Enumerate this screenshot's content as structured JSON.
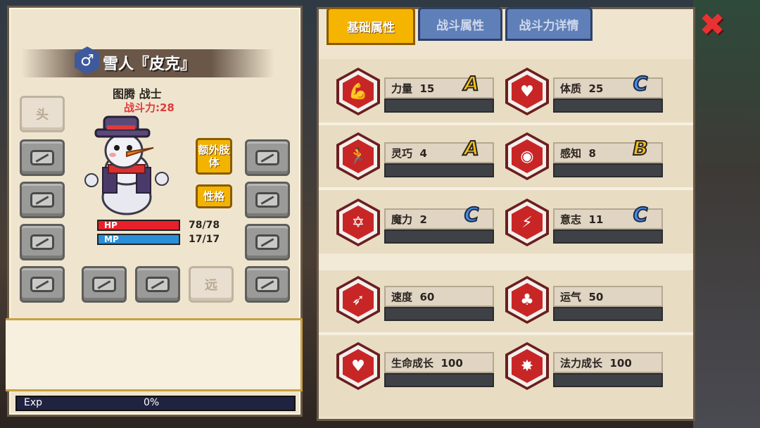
{
  "character": {
    "gender_symbol": "♂",
    "name": "雪人『皮克』",
    "subtitle": "图腾 战士",
    "power": "战斗力:28",
    "hp_label": "HP",
    "hp": 78,
    "hp_max": 78,
    "hp_text": "78/78",
    "mp_label": "MP",
    "mp": 17,
    "mp_max": 17,
    "mp_text": "17/17",
    "extra_limb_button": "额外肢体",
    "personality_button": "性格",
    "head_slot": "头",
    "ranged_slot": "远",
    "exp_label": "Exp",
    "exp_value": "0%",
    "exp_fraction": 0.0,
    "hp_color": "#e8202a",
    "mp_color": "#2a8fd8"
  },
  "tabs": [
    {
      "label": "基础属性",
      "active": true
    },
    {
      "label": "战斗属性",
      "active": false
    },
    {
      "label": "战斗力详情",
      "active": false
    }
  ],
  "attributes": [
    {
      "key": "strength",
      "label": "力量",
      "value": "15",
      "grade": "A",
      "icon": "flexed-arm-icon"
    },
    {
      "key": "constitution",
      "label": "体质",
      "value": "25",
      "grade": "C",
      "icon": "muscle-torso-icon"
    },
    {
      "key": "agility",
      "label": "灵巧",
      "value": "4",
      "grade": "A",
      "icon": "running-man-icon"
    },
    {
      "key": "perception",
      "label": "感知",
      "value": "8",
      "grade": "B",
      "icon": "eye-icon"
    },
    {
      "key": "magic",
      "label": "魔力",
      "value": "2",
      "grade": "C",
      "icon": "hexagram-icon"
    },
    {
      "key": "will",
      "label": "意志",
      "value": "11",
      "grade": "C",
      "icon": "head-lightning-icon"
    },
    {
      "key": "speed",
      "label": "速度",
      "value": "60",
      "grade": "",
      "icon": "wing-icon"
    },
    {
      "key": "luck",
      "label": "运气",
      "value": "50",
      "grade": "",
      "icon": "clover-icon"
    },
    {
      "key": "hp_growth",
      "label": "生命成长",
      "value": "100",
      "grade": "",
      "icon": "heart-icon"
    },
    {
      "key": "mp_growth",
      "label": "法力成长",
      "value": "100",
      "grade": "",
      "icon": "magic-rune-icon"
    }
  ],
  "colors": {
    "grade_a": "#f4c218",
    "grade_b": "#f4c218",
    "grade_c": "#4a8de0",
    "icon_red": "#c82626",
    "close": "#e83232"
  },
  "close_icon": "close-icon"
}
